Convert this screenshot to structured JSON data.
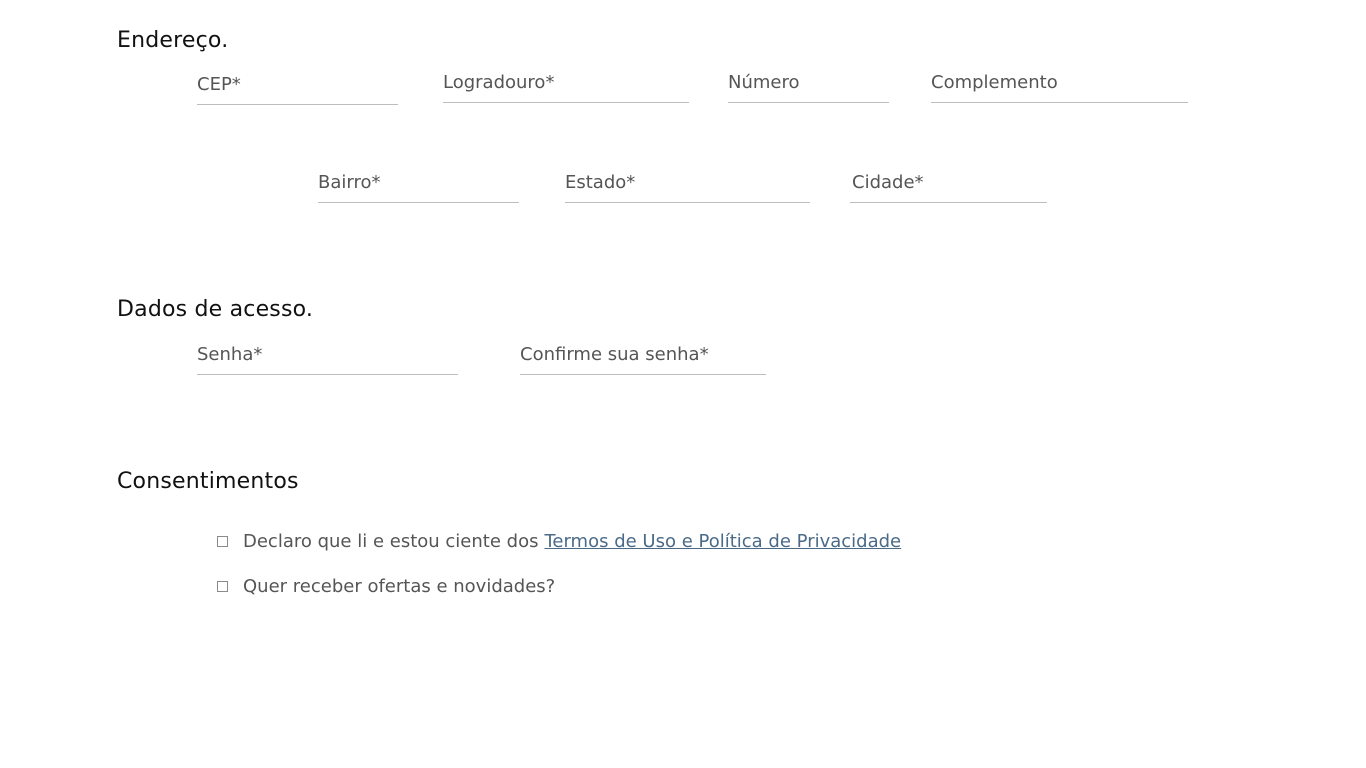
{
  "address_section": {
    "title": "Endereço.",
    "fields": {
      "cep": "CEP*",
      "logradouro": "Logradouro*",
      "numero": "Número",
      "complemento": "Complemento",
      "bairro": "Bairro*",
      "estado": "Estado*",
      "cidade": "Cidade*"
    }
  },
  "access_section": {
    "title": "Dados de acesso.",
    "fields": {
      "senha": "Senha*",
      "confirme_senha": "Confirme sua senha*"
    }
  },
  "consents_section": {
    "title": "Consentimentos",
    "terms_text": "Declaro que li e estou ciente dos",
    "terms_link": "Termos de Uso e Política de Privacidade",
    "offers_text": "Quer receber ofertas e novidades?"
  }
}
